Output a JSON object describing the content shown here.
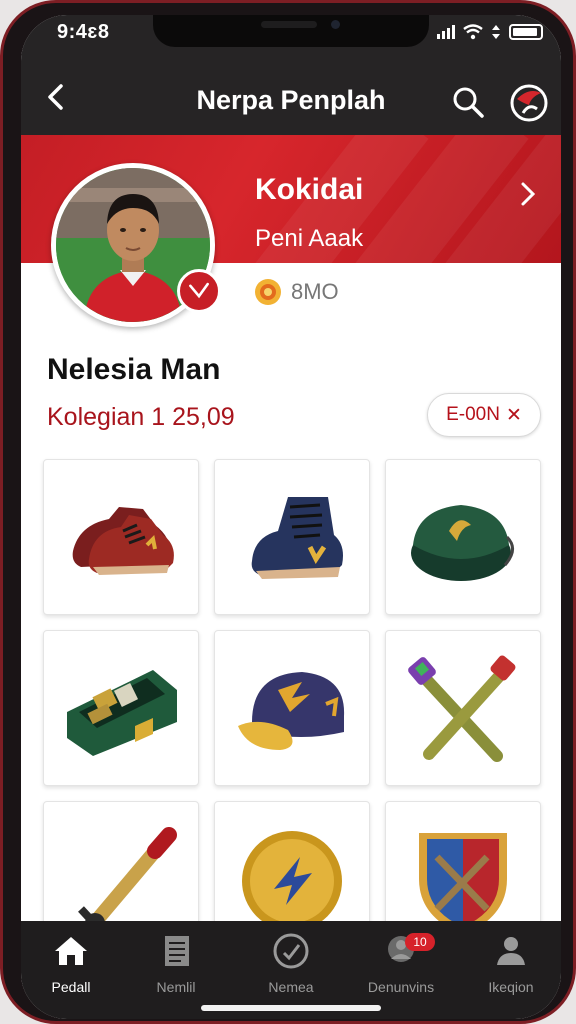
{
  "status_bar": {
    "time": "9:4ɛ8"
  },
  "nav": {
    "title": "Nerpa Penplah"
  },
  "profile": {
    "name": "Kokidai",
    "subtitle": "Peni Aaak",
    "coins": "8MO"
  },
  "section": {
    "title": "Nelesia Man",
    "collection_label": "Kolegian 1 25,09",
    "filter_chip": "E-00N",
    "filter_chip_close": "✕"
  },
  "items": [
    {
      "name": "red-boots"
    },
    {
      "name": "blue-hightop-boots"
    },
    {
      "name": "green-pouch"
    },
    {
      "name": "green-chest"
    },
    {
      "name": "purple-cap"
    },
    {
      "name": "crossed-torches"
    },
    {
      "name": "red-torch"
    },
    {
      "name": "gold-coin-badge"
    },
    {
      "name": "heraldic-shield"
    }
  ],
  "tabs": [
    {
      "label": "Pedall",
      "icon": "home-icon",
      "active": true
    },
    {
      "label": "Nemlil",
      "icon": "notes-icon",
      "active": false
    },
    {
      "label": "Nemea",
      "icon": "check-circle-icon",
      "active": false
    },
    {
      "label": "Denunvins",
      "icon": "group-icon",
      "active": false,
      "badge": "10"
    },
    {
      "label": "Ikeqion",
      "icon": "person-icon",
      "active": false
    }
  ],
  "colors": {
    "brand_red": "#c41e25",
    "nav_dark": "#262425",
    "tab_dark": "#1f1d1e"
  }
}
